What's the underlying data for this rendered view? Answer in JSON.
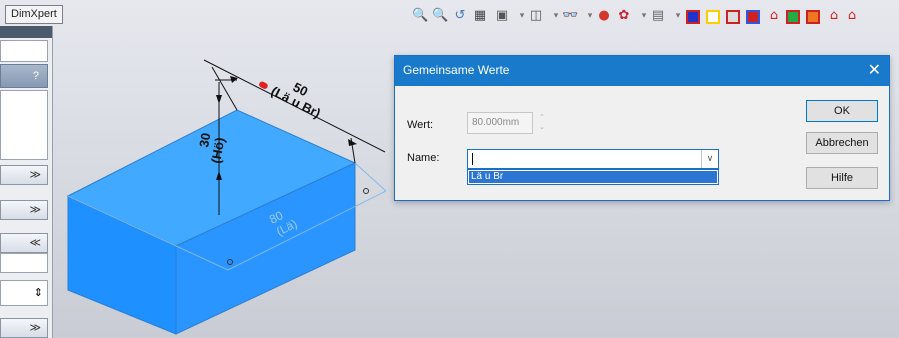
{
  "tab": {
    "label": "DimXpert"
  },
  "left_panel": {
    "help_label": "?",
    "collapse_glyph": "≫",
    "expand_glyph": "≪",
    "spinner_glyph": "⇕"
  },
  "toolbar": {
    "icons": [
      "zoom-to-fit-icon",
      "zoom-area-icon",
      "previous-view-icon",
      "section-view-icon",
      "view-orientation-icon",
      "display-style-icon",
      "hide-show-icon",
      "edit-appearance-icon",
      "apply-scene-icon",
      "view-settings-icon"
    ],
    "colors": [
      "#2233cc",
      "#ffdd00",
      "#3355dd",
      "#dd2222",
      "#22aa44",
      "#ee7722"
    ]
  },
  "model": {
    "dim_top_value": "50",
    "dim_top_name": "(Lä u Br)",
    "dim_left_value": "30",
    "dim_left_name": "(Hö)",
    "dim_bottom_value": "80",
    "dim_bottom_name": "(Lä)",
    "face_color": "#1e90ff",
    "top_face_color": "#3aa5ff"
  },
  "dialog": {
    "title": "Gemeinsame Werte",
    "close_glyph": "✕",
    "wert_label": "Wert:",
    "wert_value": "80.000mm",
    "name_label": "Name:",
    "name_value": "",
    "dropdown_options": [
      "Lä u Br"
    ],
    "ok_label": "OK",
    "cancel_label": "Abbrechen",
    "help_label": "Hilfe"
  }
}
